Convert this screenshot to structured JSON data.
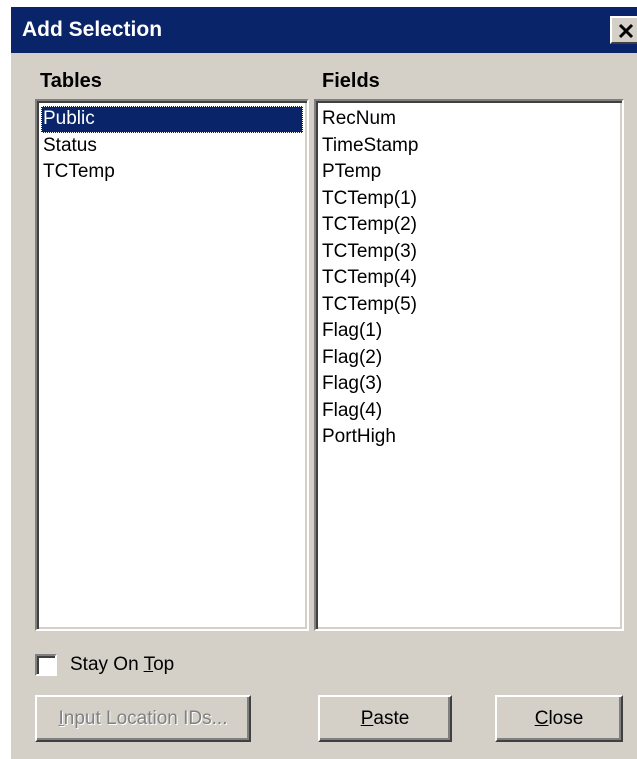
{
  "window": {
    "title": "Add Selection",
    "close_icon": "close-x-icon"
  },
  "tables": {
    "label": "Tables",
    "items": [
      "Public",
      "Status",
      "TCTemp"
    ],
    "selected": "Public"
  },
  "fields": {
    "label": "Fields",
    "items": [
      "RecNum",
      "TimeStamp",
      "PTemp",
      "TCTemp(1)",
      "TCTemp(2)",
      "TCTemp(3)",
      "TCTemp(4)",
      "TCTemp(5)",
      "Flag(1)",
      "Flag(2)",
      "Flag(3)",
      "Flag(4)",
      "PortHigh"
    ]
  },
  "stay_on_top": {
    "label_before": "Stay On ",
    "accel": "T",
    "label_after": "op",
    "checked": false
  },
  "buttons": {
    "input_location": {
      "accel": "I",
      "rest": "nput Location IDs...",
      "enabled": false
    },
    "paste": {
      "accel": "P",
      "rest": "aste"
    },
    "close": {
      "accel": "C",
      "rest": "lose"
    }
  },
  "colors": {
    "titlebar": "#0a246a",
    "face": "#d4d0c8",
    "selection": "#0a246a"
  }
}
